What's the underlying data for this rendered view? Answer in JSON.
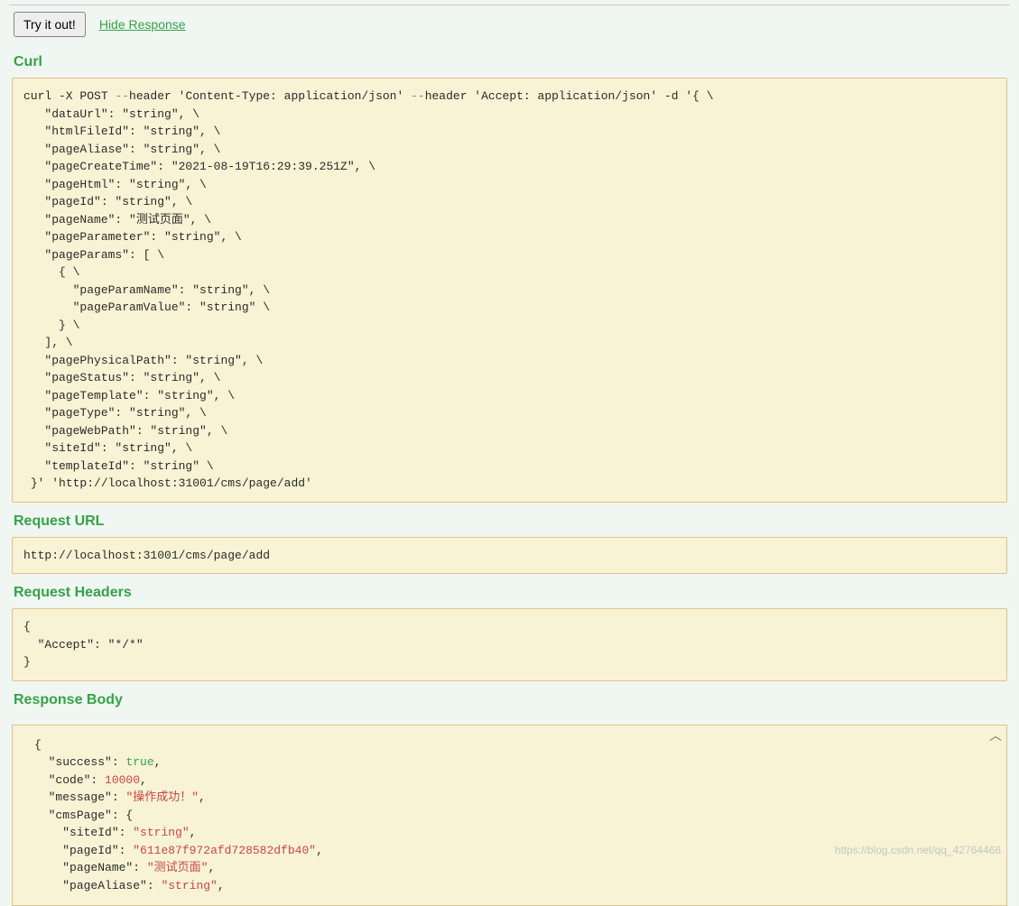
{
  "topbar": {
    "try_label": "Try it out!",
    "hide_label": "Hide Response"
  },
  "sections": {
    "curl_title": "Curl",
    "req_url_title": "Request URL",
    "req_headers_title": "Request Headers",
    "resp_body_title": "Response Body"
  },
  "curl": {
    "method": "POST",
    "headers": [
      "Content-Type: application/json",
      "Accept: application/json"
    ],
    "body_fields": {
      "dataUrl": "string",
      "htmlFileId": "string",
      "pageAliase": "string",
      "pageCreateTime": "2021-08-19T16:29:39.251Z",
      "pageHtml": "string",
      "pageId": "string",
      "pageName": "测试页面",
      "pageParameter": "string",
      "pageParams": [
        {
          "pageParamName": "string",
          "pageParamValue": "string"
        }
      ],
      "pagePhysicalPath": "string",
      "pageStatus": "string",
      "pageTemplate": "string",
      "pageType": "string",
      "pageWebPath": "string",
      "siteId": "string",
      "templateId": "string"
    },
    "url": "http://localhost:31001/cms/page/add",
    "raw": "curl -X POST --header 'Content-Type: application/json' --header 'Accept: application/json' -d '{ \\\n   \"dataUrl\": \"string\", \\\n   \"htmlFileId\": \"string\", \\\n   \"pageAliase\": \"string\", \\\n   \"pageCreateTime\": \"2021-08-19T16:29:39.251Z\", \\\n   \"pageHtml\": \"string\", \\\n   \"pageId\": \"string\", \\\n   \"pageName\": \"测试页面\", \\\n   \"pageParameter\": \"string\", \\\n   \"pageParams\": [ \\\n     { \\\n       \"pageParamName\": \"string\", \\\n       \"pageParamValue\": \"string\" \\\n     } \\\n   ], \\\n   \"pagePhysicalPath\": \"string\", \\\n   \"pageStatus\": \"string\", \\\n   \"pageTemplate\": \"string\", \\\n   \"pageType\": \"string\", \\\n   \"pageWebPath\": \"string\", \\\n   \"siteId\": \"string\", \\\n   \"templateId\": \"string\" \\\n }' 'http://localhost:31001/cms/page/add'"
  },
  "request_url": "http://localhost:31001/cms/page/add",
  "request_headers_raw": "{\n  \"Accept\": \"*/*\"\n}",
  "request_headers": {
    "Accept": "*/*"
  },
  "response_body": {
    "success": true,
    "code": 10000,
    "message": "操作成功！",
    "cmsPage": {
      "siteId": "string",
      "pageId": "611e87f972afd728582dfb40",
      "pageName": "测试页面",
      "pageAliase": "string"
    }
  },
  "watermark": "https://blog.csdn.net/qq_42764468"
}
